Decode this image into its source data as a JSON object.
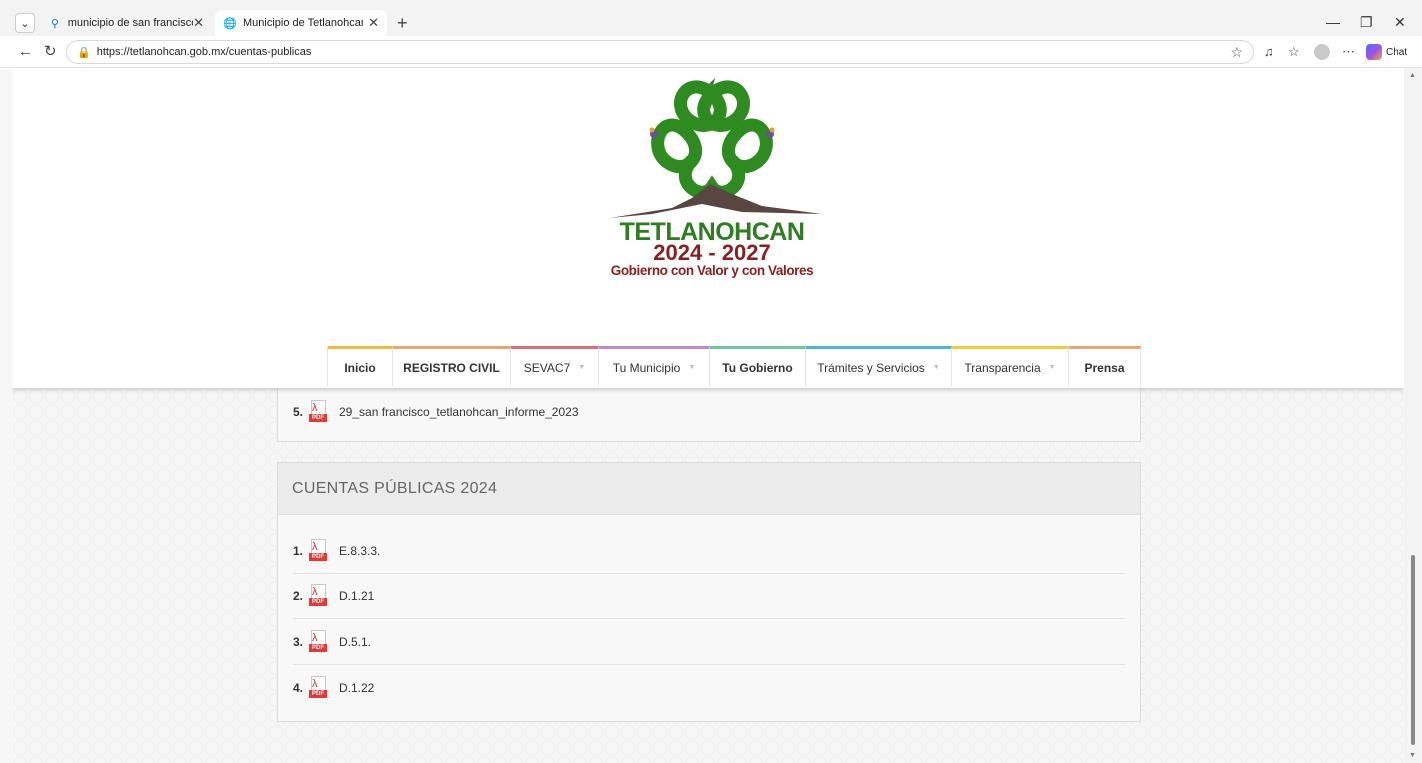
{
  "browser": {
    "tabs": [
      {
        "title": "municipio de san francisco tetlanohcan",
        "active": false,
        "icon": "search-icon"
      },
      {
        "title": "Municipio de Tetlanohcan",
        "active": true,
        "icon": "globe-icon"
      }
    ],
    "url": "https://tetlanohcan.gob.mx/cuentas-publicas",
    "copilot_label": "Chat"
  },
  "logo": {
    "title": "TETLANOHCAN",
    "years": "2024 - 2027",
    "slogan": "Gobierno con Valor y con Valores"
  },
  "nav": {
    "items": [
      {
        "label": "Inicio",
        "dropdown": false,
        "color": "#f2b93b"
      },
      {
        "label": "REGISTRO CIVIL",
        "dropdown": false,
        "color": "#f0a36a"
      },
      {
        "label": "SEVAC7",
        "dropdown": true,
        "color": "#e06b7a"
      },
      {
        "label": "Tu Municipio",
        "dropdown": true,
        "color": "#b98ad6"
      },
      {
        "label": "Tu Gobierno",
        "dropdown": false,
        "color": "#6ec8a0"
      },
      {
        "label": "Trámites y Servicios",
        "dropdown": true,
        "color": "#4cb8d6"
      },
      {
        "label": "Transparencia",
        "dropdown": true,
        "color": "#f5c842"
      },
      {
        "label": "Prensa",
        "dropdown": false,
        "color": "#f0a36a"
      }
    ]
  },
  "previous_section": {
    "items": [
      {
        "number": "5.",
        "name": "29_san francisco_tetlanohcan_informe_2023"
      }
    ]
  },
  "section_2024": {
    "title": "CUENTAS PÚBLICAS 2024",
    "items": [
      {
        "number": "1.",
        "name": "E.8.3.3."
      },
      {
        "number": "2.",
        "name": "D.1.21"
      },
      {
        "number": "3.",
        "name": "D.5.1."
      },
      {
        "number": "4.",
        "name": "D.1.22"
      }
    ]
  },
  "pdf_badge": "PDF"
}
